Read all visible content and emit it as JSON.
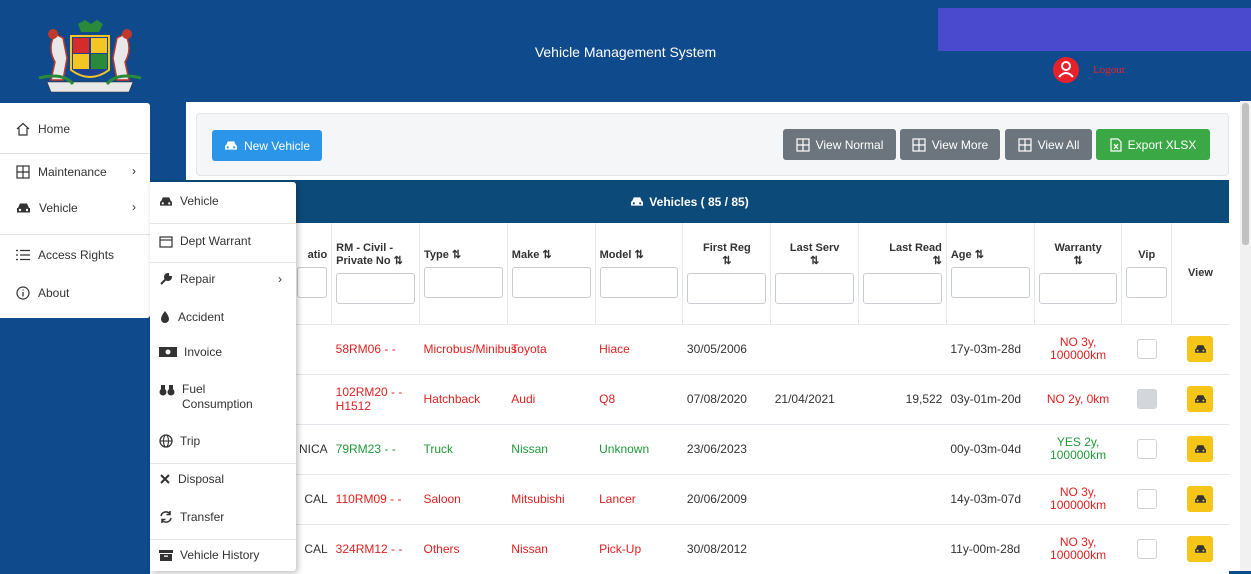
{
  "header": {
    "title": "Vehicle Management System",
    "logout": "Logout"
  },
  "sidebar": {
    "items": [
      {
        "label": "Home"
      },
      {
        "label": "Maintenance"
      },
      {
        "label": "Vehicle"
      },
      {
        "label": "Access Rights"
      },
      {
        "label": "About"
      }
    ]
  },
  "toolbar": {
    "new_vehicle": "New Vehicle",
    "view_normal": "View Normal",
    "view_more": "View More",
    "view_all": "View All",
    "export": "Export XLSX"
  },
  "table": {
    "title": "Vehicles ( 85 / 85)",
    "headers": [
      "atio",
      "RM - Civil - Private No",
      "Type",
      "Make",
      "Model",
      "First Reg",
      "Last Serv",
      "Last Read",
      "Age",
      "Warranty",
      "Vip",
      "View"
    ],
    "sort_glyph": "⇅",
    "rows": [
      {
        "c0": "",
        "rm": "58RM06 - -",
        "type": "Microbus/Minibus",
        "make": "Toyota",
        "model": "Hiace",
        "first_reg": "30/05/2006",
        "last_serv": "",
        "last_read": "",
        "age": "17y-03m-28d",
        "warranty": "NO 3y, 100000km",
        "vip": false,
        "color": "#e02020"
      },
      {
        "c0": "",
        "rm": "102RM20 - - H1512",
        "type": "Hatchback",
        "make": "Audi",
        "model": "Q8",
        "first_reg": "07/08/2020",
        "last_serv": "21/04/2021",
        "last_read": "19,522",
        "age": "03y-01m-20d",
        "warranty": "NO 2y, 0km",
        "vip": true,
        "color": "#e02020"
      },
      {
        "c0": "NICA",
        "rm": "79RM23 - -",
        "type": "Truck",
        "make": "Nissan",
        "model": "Unknown",
        "first_reg": "23/06/2023",
        "last_serv": "",
        "last_read": "",
        "age": "00y-03m-04d",
        "warranty": "YES 2y, 100000km",
        "vip": false,
        "color": "#1f9a3a"
      },
      {
        "c0": "CAL",
        "rm": "110RM09 - -",
        "type": "Saloon",
        "make": "Mitsubishi",
        "model": "Lancer",
        "first_reg": "20/06/2009",
        "last_serv": "",
        "last_read": "",
        "age": "14y-03m-07d",
        "warranty": "NO 3y, 100000km",
        "vip": false,
        "color": "#e02020"
      },
      {
        "c0": "CAL",
        "rm": "324RM12 - -",
        "type": "Others",
        "make": "Nissan",
        "model": "Pick-Up",
        "first_reg": "30/08/2012",
        "last_serv": "",
        "last_read": "",
        "age": "11y-00m-28d",
        "warranty": "NO 3y, 100000km",
        "vip": false,
        "color": "#e02020"
      }
    ]
  },
  "submenu": {
    "items": [
      {
        "label": "Vehicle"
      },
      {
        "label": "Dept Warrant"
      },
      {
        "label": "Repair"
      },
      {
        "label": "Accident"
      },
      {
        "label": "Invoice"
      },
      {
        "label": "Fuel Consumption"
      },
      {
        "label": "Trip"
      },
      {
        "label": "Disposal"
      },
      {
        "label": "Transfer"
      },
      {
        "label": "Vehicle History"
      }
    ]
  }
}
